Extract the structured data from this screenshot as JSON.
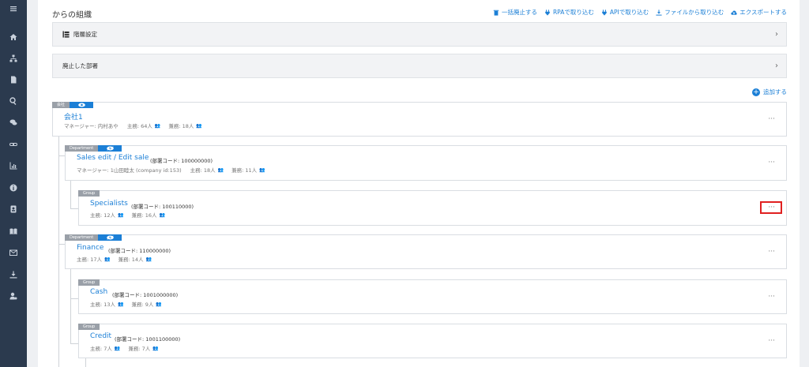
{
  "page": {
    "title": "からの組織"
  },
  "toolbar": {
    "abolish": "一括廃止する",
    "rpa": "RPAで取り込む",
    "api": "APIで取り込む",
    "file": "ファイルから取り込む",
    "export": "エクスポートする"
  },
  "panels": {
    "hierarchy": "階層設定",
    "abolished": "廃止した部署"
  },
  "add_label": "追加する",
  "company": {
    "tag": "会社",
    "name": "会社1",
    "manager": "マネージャー: 内村あや",
    "main": "主務: 64人",
    "sub": "兼務: 18人"
  },
  "units": [
    {
      "tag": "Department",
      "name": "Sales edit / Edit sale",
      "code": "(部署コード: 100000000)",
      "manager": "マネージャー: 1山田睦太 (company id:153)",
      "main": "主務: 18人",
      "sub": "兼務: 11人"
    },
    {
      "tag": "Group",
      "name": "Specialists",
      "code": "(部署コード: 100110000)",
      "main": "主務: 12人",
      "sub": "兼務: 16人"
    },
    {
      "tag": "Department",
      "name": "Finance",
      "code": "(部署コード: 110000000)",
      "main": "主務: 17人",
      "sub": "兼務: 14人"
    },
    {
      "tag": "Group",
      "name": "Cash",
      "code": "(部署コード: 1001000000)",
      "main": "主務: 13人",
      "sub": "兼務: 9人"
    },
    {
      "tag": "Group",
      "name": "Credit",
      "code": "(部署コード: 1001100000)",
      "main": "主務: 7人",
      "sub": "兼務: 7人"
    }
  ],
  "more": "···",
  "chevron": "›",
  "icons": [
    "menu-icon",
    "home-icon",
    "org-chart-icon",
    "document-icon",
    "search-icon",
    "chat-icon",
    "link-icon",
    "chart-icon",
    "info-icon",
    "contact-icon",
    "book-icon",
    "mail-icon",
    "download-icon",
    "user-settings-icon",
    "trash-icon",
    "rpa-icon",
    "api-icon",
    "file-download-icon",
    "cloud-upload-icon",
    "eye-icon",
    "people-icon"
  ]
}
